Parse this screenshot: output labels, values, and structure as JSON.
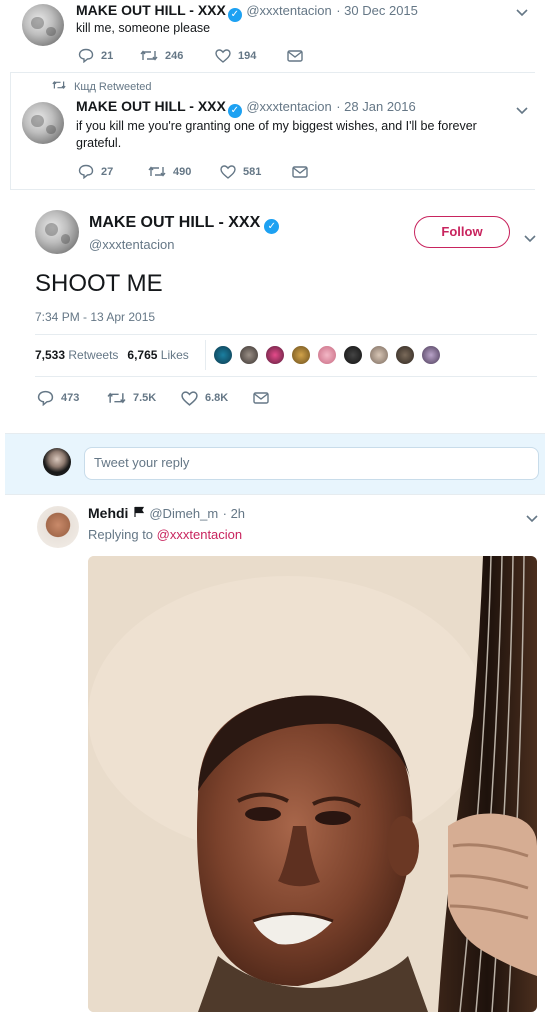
{
  "tweet1": {
    "name": "MAKE OUT HILL - XXX",
    "handle": "@xxxtentacion",
    "date": "· 30 Dec 2015",
    "text": "kill me, someone please",
    "replies": "21",
    "retweets": "246",
    "likes": "194"
  },
  "tweet2": {
    "retweeted_by": "Кщд Retweeted",
    "name": "MAKE OUT HILL - XXX",
    "handle": "@xxxtentacion",
    "date": "· 28 Jan 2016",
    "text": "if you kill me you're granting one of my biggest wishes, and I'll be forever grateful.",
    "replies": "27",
    "retweets": "490",
    "likes": "581"
  },
  "main_tweet": {
    "name": "MAKE OUT HILL - XXX",
    "handle": "@xxxtentacion",
    "follow_label": "Follow",
    "text": "SHOOT ME",
    "timestamp": "7:34 PM - 13 Apr 2015",
    "retweet_count": "7,533",
    "retweet_label": "Retweets",
    "like_count": "6,765",
    "like_label": "Likes",
    "replies": "473",
    "retweets": "7.5K",
    "likes": "6.8K"
  },
  "reply_box": {
    "placeholder": "Tweet your reply"
  },
  "reply": {
    "name": "Mehdi",
    "handle": "@Dimeh_m",
    "time": "· 2h",
    "replying_prefix": "Replying to",
    "replying_to": "@xxxtentacion"
  },
  "colors": {
    "accent": "#1da1f2",
    "muted": "#657786",
    "follow_border": "#c8245e"
  }
}
